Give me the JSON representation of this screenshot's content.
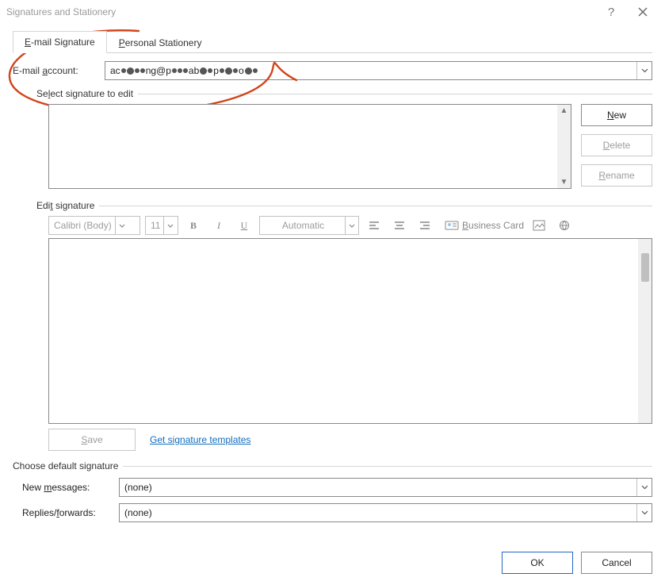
{
  "window": {
    "title": "Signatures and Stationery"
  },
  "tabs": {
    "email": "E-mail Signature",
    "stationery": "Personal Stationery"
  },
  "account": {
    "label_pre": "E-mail ",
    "label_u": "a",
    "label_post": "ccount:",
    "value_prefix": "ac",
    "value_mid": "ng@p",
    "value_mid2": "ab",
    "value_mid3": "p",
    "value_end": "o"
  },
  "sections": {
    "select_pre": "Se",
    "select_u": "l",
    "select_post": "ect signature to edit",
    "edit_pre": "Edi",
    "edit_u": "t",
    "edit_post": " signature",
    "choose": "Choose default signature"
  },
  "buttons": {
    "new_u": "N",
    "new_post": "ew",
    "delete_u": "D",
    "delete_post": "elete",
    "rename_u": "R",
    "rename_post": "ename",
    "save_u": "S",
    "save_post": "ave",
    "ok": "OK",
    "cancel": "Cancel"
  },
  "toolbar": {
    "font": "Calibri (Body)",
    "size": "11",
    "color": "Automatic",
    "bizcard_u": "B",
    "bizcard_post": "usiness Card"
  },
  "link": {
    "templates": "Get signature templates"
  },
  "defaults": {
    "new_pre": "New ",
    "new_u": "m",
    "new_post": "essages:",
    "replies_pre": "Replies/",
    "replies_u": "f",
    "replies_post": "orwards:",
    "none": "(none)"
  }
}
